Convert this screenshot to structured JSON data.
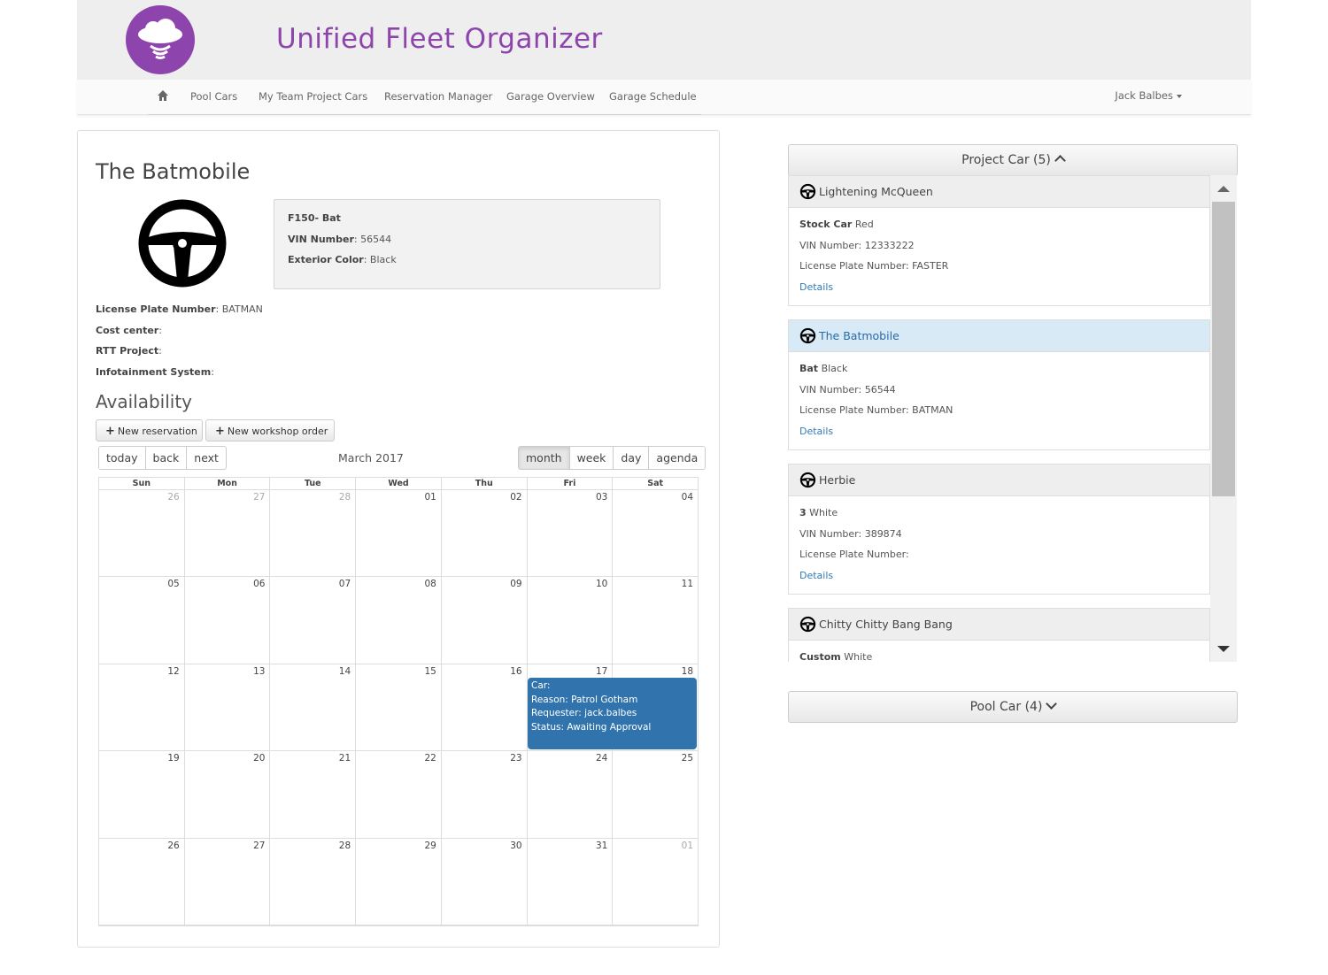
{
  "header": {
    "title": "Unified Fleet Organizer",
    "logo_icon": "cloud-signal-logo",
    "brand_color": "#8e44ad"
  },
  "nav": {
    "home_icon": "home-icon",
    "items": [
      "Pool Cars",
      "My Team Project Cars",
      "Reservation Manager",
      "Garage Overview",
      "Garage Schedule"
    ],
    "user": "Jack Balbes"
  },
  "car": {
    "title": "The Batmobile",
    "icon": "steering-wheel-icon",
    "specs": {
      "model_label": "F150- Bat",
      "vin_label": "VIN Number",
      "vin_value": "56544",
      "color_label": "Exterior Color",
      "color_value": "Black"
    },
    "details": {
      "plate_label": "License Plate Number",
      "plate_value": "BATMAN",
      "cost_label": "Cost center",
      "rtt_label": "RTT Project",
      "infotainment_label": "Infotainment System"
    }
  },
  "availability": {
    "title": "Availability",
    "new_reservation": "New reservation",
    "new_workshop_order": "New workshop order",
    "toolbar": {
      "today": "today",
      "back": "back",
      "next": "next",
      "label": "March 2017",
      "views": {
        "month": "month",
        "week": "week",
        "day": "day",
        "agenda": "agenda"
      },
      "active_view": "month"
    },
    "weekdays": [
      "Sun",
      "Mon",
      "Tue",
      "Wed",
      "Thu",
      "Fri",
      "Sat"
    ],
    "weeks": [
      [
        "26",
        "27",
        "28",
        "01",
        "02",
        "03",
        "04"
      ],
      [
        "05",
        "06",
        "07",
        "08",
        "09",
        "10",
        "11"
      ],
      [
        "12",
        "13",
        "14",
        "15",
        "16",
        "17",
        "18"
      ],
      [
        "19",
        "20",
        "21",
        "22",
        "23",
        "24",
        "25"
      ],
      [
        "26",
        "27",
        "28",
        "29",
        "30",
        "31",
        "01"
      ]
    ],
    "event": {
      "car": "Car:",
      "reason": "Reason: Patrol Gotham",
      "requester": "Requester: jack.balbes",
      "status": "Status: Awaiting Approval",
      "color": "#3174ad"
    }
  },
  "project_cars": {
    "header": "Project Car (5)",
    "cars": [
      {
        "name": "Lightening McQueen",
        "model": "Stock Car",
        "color": "Red",
        "vin": "VIN Number: 12333222",
        "plate": "License Plate Number: FASTER",
        "details": "Details",
        "selected": false
      },
      {
        "name": "The Batmobile",
        "model": "Bat",
        "color": "Black",
        "vin": "VIN Number: 56544",
        "plate": "License Plate Number: BATMAN",
        "details": "Details",
        "selected": true
      },
      {
        "name": "Herbie",
        "model": "3",
        "color": "White",
        "vin": "VIN Number: 389874",
        "plate": "License Plate Number:",
        "details": "Details",
        "selected": false
      },
      {
        "name": "Chitty Chitty Bang Bang",
        "model": "Custom",
        "color": "White",
        "vin": "",
        "plate": "",
        "details": "",
        "selected": false
      }
    ]
  },
  "pool_cars": {
    "header": "Pool Car (4)"
  }
}
